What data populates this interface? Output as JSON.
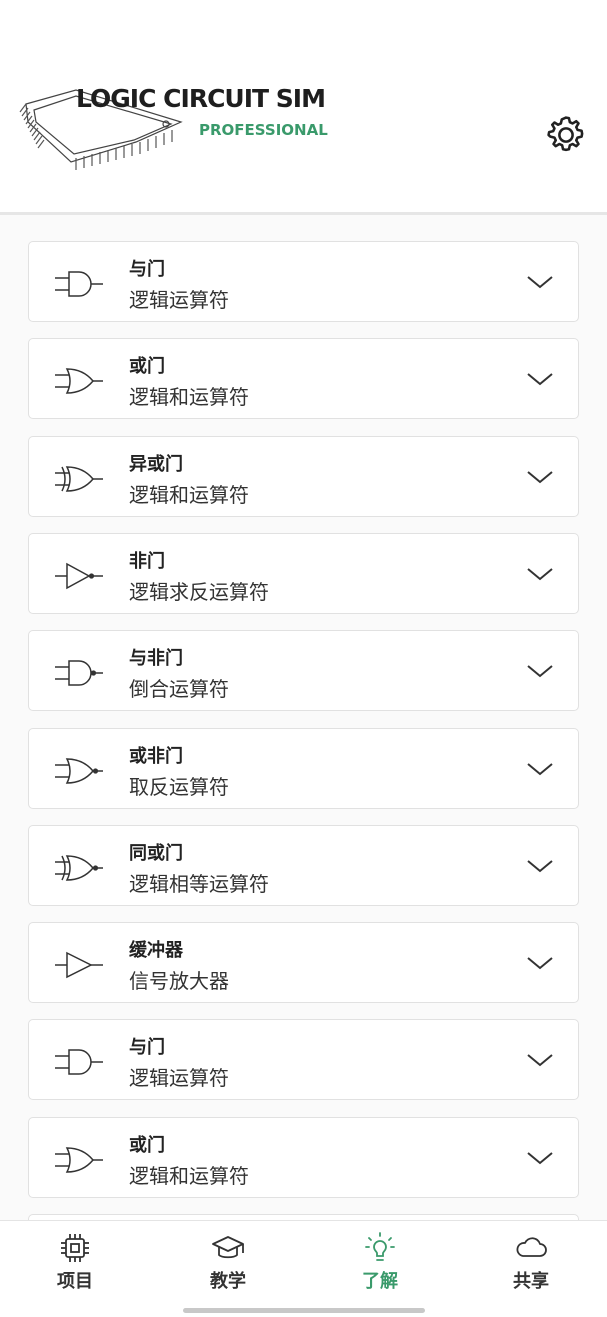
{
  "app": {
    "logo_title": "LOGIC CIRCUIT SIM",
    "logo_subtitle": "PROFESSIONAL",
    "accent_color": "#3a9a6b"
  },
  "gates": [
    {
      "title": "与门",
      "subtitle": "逻辑运算符",
      "icon": "and-gate-icon"
    },
    {
      "title": "或门",
      "subtitle": "逻辑和运算符",
      "icon": "or-gate-icon"
    },
    {
      "title": "异或门",
      "subtitle": "逻辑和运算符",
      "icon": "xor-gate-icon"
    },
    {
      "title": "非门",
      "subtitle": "逻辑求反运算符",
      "icon": "not-gate-icon"
    },
    {
      "title": "与非门",
      "subtitle": "倒合运算符",
      "icon": "nand-gate-icon"
    },
    {
      "title": "或非门",
      "subtitle": "取反运算符",
      "icon": "nor-gate-icon"
    },
    {
      "title": "同或门",
      "subtitle": "逻辑相等运算符",
      "icon": "xnor-gate-icon"
    },
    {
      "title": "缓冲器",
      "subtitle": "信号放大器",
      "icon": "buffer-gate-icon"
    },
    {
      "title": "与门",
      "subtitle": "逻辑运算符",
      "icon": "and-gate-icon"
    },
    {
      "title": "或门",
      "subtitle": "逻辑和运算符",
      "icon": "or-gate-icon"
    }
  ],
  "nav": {
    "items": [
      {
        "label": "项目",
        "icon": "chip-icon"
      },
      {
        "label": "教学",
        "icon": "graduation-cap-icon"
      },
      {
        "label": "了解",
        "icon": "lightbulb-icon",
        "active": true
      },
      {
        "label": "共享",
        "icon": "cloud-icon"
      }
    ]
  }
}
